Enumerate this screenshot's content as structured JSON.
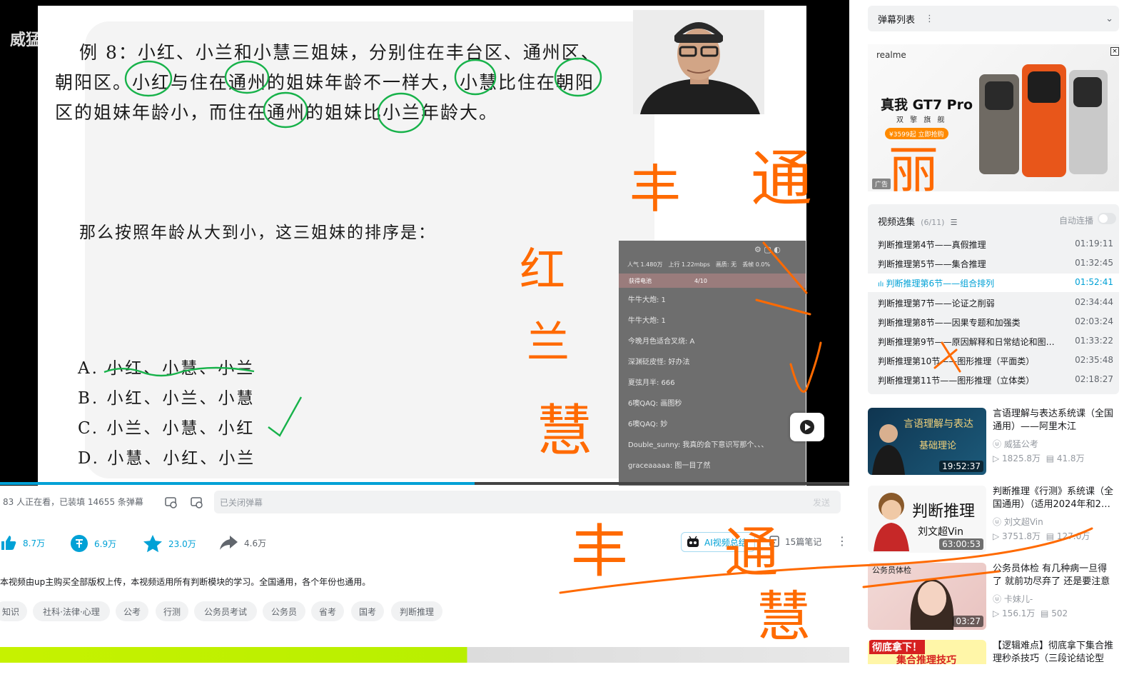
{
  "slide": {
    "watermark": "威猛公考",
    "line1": "例 8：小红、小兰和小慧三姐妹，分别住在丰台区、通州区、",
    "line2": "朝阳区。小红与住在通州的姐妹年龄不一样大，小慧比住在朝阳",
    "line3": "区的姐妹年龄小，而住在通州的姐妹比小兰年龄大。",
    "question": "那么按照年龄从大到小，这三姐妹的排序是：",
    "options": [
      "A. 小红、小慧、小兰",
      "B. 小红、小兰、小慧",
      "C. 小兰、小慧、小红",
      "D. 小慧、小红、小兰"
    ],
    "ink_notes": [
      "丰",
      "通",
      "红",
      "兰",
      "慧",
      "丰",
      "通",
      "慧",
      "丽"
    ]
  },
  "live": {
    "stats": [
      "人气 1.480万",
      "上行 1.22mbps",
      "画质: 无",
      "丢帧 0.0%"
    ],
    "energy_label": "获得电池",
    "energy_count": "4/10",
    "chat": [
      "牛牛大炮: 1",
      "牛牛大炮: 1",
      "今晚月色适合叉烧: A",
      "深渊砭皮怪: 好办法",
      "夏弦月半: 666",
      "6噢QAQ: 画图秒",
      "6噢QAQ: 妙",
      "Double_sunny: 我真的会下意识写那个、、、",
      "graceaaaaa: 图一目了然"
    ]
  },
  "danmaku_bar": {
    "viewer_text": "83 人正在看，已装填 14655 条弹幕",
    "input_placeholder": "已关闭弹幕",
    "send_label": "发送"
  },
  "actions": {
    "like": "8.7万",
    "coin": "6.9万",
    "favorite": "23.0万",
    "share": "4.6万",
    "ai_summary": "AI视频总结",
    "notes": "15篇笔记"
  },
  "description": "本视频由up主购买全部版权上传，本视频适用所有判断模块的学习。全国通用，各个年份也通用。",
  "tags": [
    "知识",
    "社科·法律·心理",
    "公考",
    "行测",
    "公务员考试",
    "公务员",
    "省考",
    "国考",
    "判断推理"
  ],
  "sidebar": {
    "danmaku_list": "弹幕列表",
    "ad": {
      "brand": "realme",
      "title": "真我 GT7 Pro",
      "subtitle": "双 擎 旗 舰",
      "price": "¥3599起 立即抢购",
      "ad_badge": "广告"
    },
    "playlist": {
      "title": "视频选集",
      "count": "(6/11)",
      "autoplay": "自动连播",
      "items": [
        {
          "title": "判断推理第4节——真假推理",
          "duration": "01:19:11"
        },
        {
          "title": "判断推理第5节——集合推理",
          "duration": "01:32:45"
        },
        {
          "title": "判断推理第6节——组合排列",
          "duration": "01:52:41"
        },
        {
          "title": "判断推理第7节——论证之削弱",
          "duration": "02:34:44"
        },
        {
          "title": "判断推理第8节——因果专题和加强类",
          "duration": "02:03:24"
        },
        {
          "title": "判断推理第9节——原因解释和日常结论和图…",
          "duration": "01:33:22"
        },
        {
          "title": "判断推理第10节——图形推理（平面类）",
          "duration": "02:35:48"
        },
        {
          "title": "判断推理第11节——图形推理（立体类）",
          "duration": "02:18:27"
        }
      ]
    },
    "recommendations": [
      {
        "title1": "言语理解与表达系统课（全国",
        "title2": "通用）——阿里木江",
        "up": "威猛公考",
        "views": "1825.8万",
        "danmaku": "41.8万",
        "duration": "19:52:37",
        "thumb_text": "言语理解与表达",
        "thumb_sub": "基础理论"
      },
      {
        "title1": "判断推理《行测》系统课（全",
        "title2": "国通用）（适用2024年和2…",
        "up": "刘文超Vin",
        "views": "3751.8万",
        "danmaku": "127.0万",
        "duration": "63:00:53",
        "thumb_text": "判断推理",
        "thumb_sub": "刘文超Vin"
      },
      {
        "title1": "公务员体检 有几种病一旦得",
        "title2": "了 就前功尽弃了 还是要注意",
        "up": "卡妹儿-",
        "views": "156.1万",
        "danmaku": "502",
        "duration": "03:27",
        "thumb_text": "公务员体检",
        "thumb_sub": ""
      },
      {
        "title1": "【逻辑难点】彻底拿下集合推",
        "title2": "理秒杀技巧（三段论结论型",
        "up": "",
        "views": "",
        "danmaku": "",
        "duration": "",
        "thumb_text": "彻底拿下！",
        "thumb_sub": "集合推理技巧"
      }
    ]
  },
  "colors": {
    "accent": "#00a1d6",
    "ink_orange": "#ff6a00",
    "circle_green": "#17b24a"
  }
}
